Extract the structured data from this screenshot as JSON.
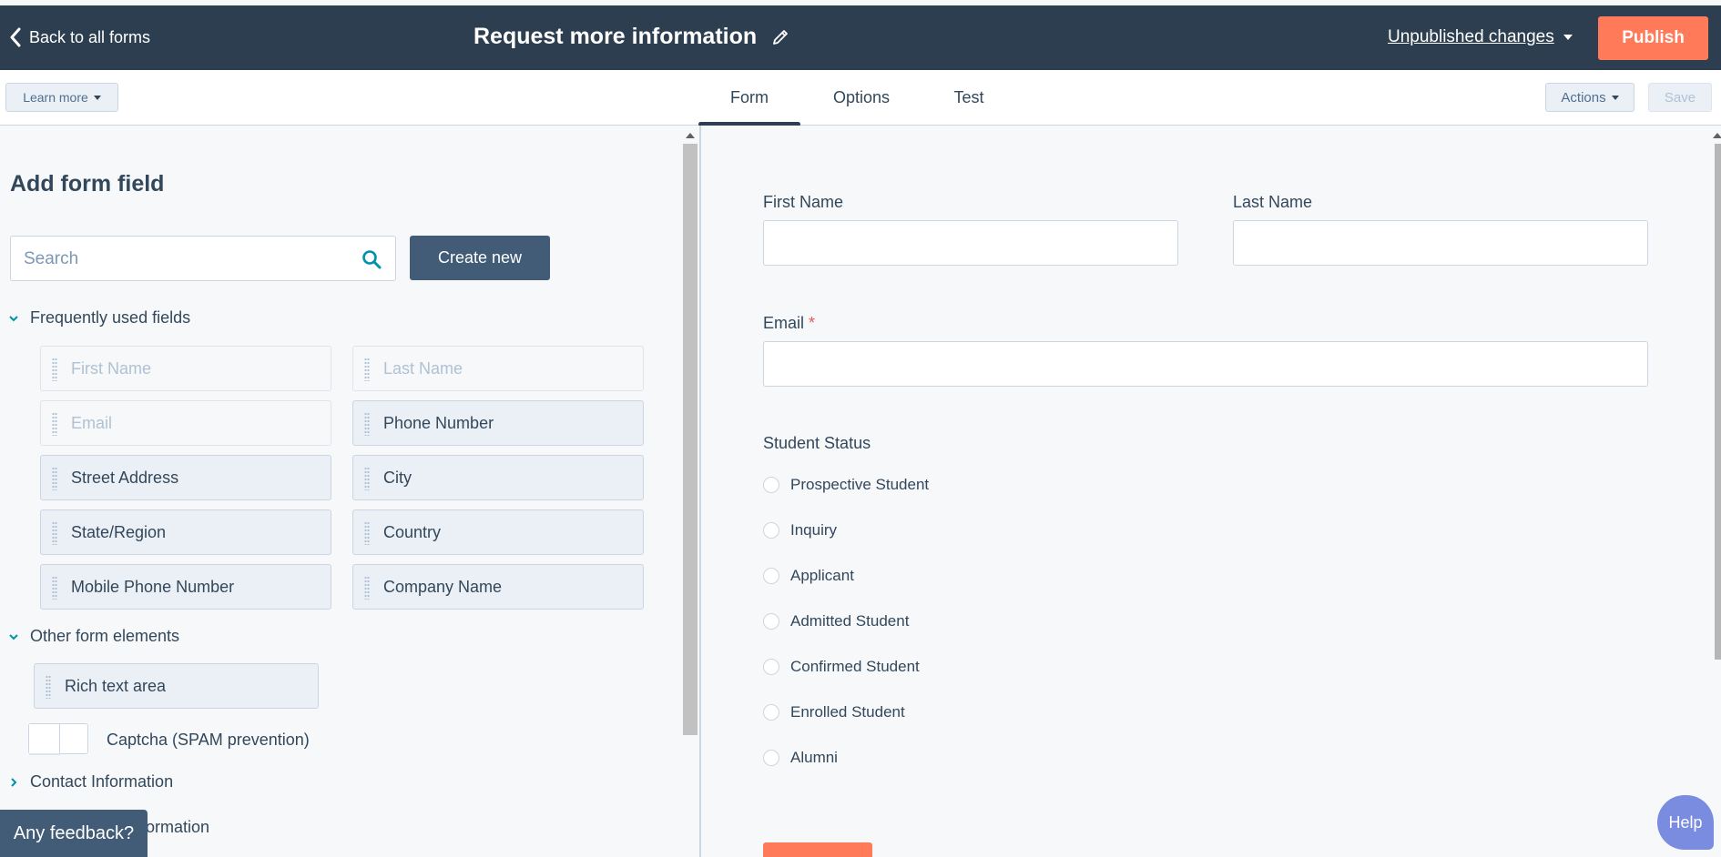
{
  "topbar": {
    "back_label": "Back to all forms",
    "title": "Request more information",
    "unpublished_label": "Unpublished changes",
    "publish_label": "Publish"
  },
  "subbar": {
    "learn_more_label": "Learn more",
    "tabs": [
      {
        "label": "Form",
        "active": true
      },
      {
        "label": "Options",
        "active": false
      },
      {
        "label": "Test",
        "active": false
      }
    ],
    "actions_label": "Actions",
    "save_label": "Save"
  },
  "left": {
    "title": "Add form field",
    "search_placeholder": "Search",
    "create_label": "Create new",
    "frequent_heading": "Frequently used fields",
    "frequent_fields": [
      {
        "label": "First Name",
        "disabled": true
      },
      {
        "label": "Last Name",
        "disabled": true
      },
      {
        "label": "Email",
        "disabled": true
      },
      {
        "label": "Phone Number",
        "disabled": false
      },
      {
        "label": "Street Address",
        "disabled": false
      },
      {
        "label": "City",
        "disabled": false
      },
      {
        "label": "State/Region",
        "disabled": false
      },
      {
        "label": "Country",
        "disabled": false
      },
      {
        "label": "Mobile Phone Number",
        "disabled": false
      },
      {
        "label": "Company Name",
        "disabled": false
      }
    ],
    "other_heading": "Other form elements",
    "rich_text_label": "Rich text area",
    "captcha_label": "Captcha (SPAM prevention)",
    "contact_heading": "Contact Information",
    "partial_heading": "ormation",
    "feedback_label": "Any feedback?"
  },
  "preview": {
    "first_name_label": "First Name",
    "last_name_label": "Last Name",
    "email_label": "Email",
    "required_mark": "*",
    "student_status_label": "Student Status",
    "status_options": [
      "Prospective Student",
      "Inquiry",
      "Applicant",
      "Admitted Student",
      "Confirmed Student",
      "Enrolled Student",
      "Alumni"
    ]
  },
  "help_label": "Help",
  "colors": {
    "topbar_bg": "#2d3e50",
    "publish_bg": "#ff7a59",
    "create_bg": "#425b76",
    "help_bg": "#7a8ce0"
  }
}
